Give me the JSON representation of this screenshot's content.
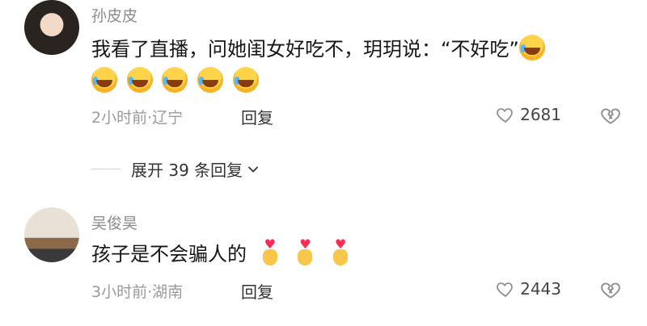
{
  "comments": [
    {
      "username": "孙皮皮",
      "text": "我看了直播，问她闺女好吃不，玥玥说：“不好吃”",
      "emoji_after_text": "laughing-emoji",
      "emoji_line": [
        "laughing-emoji",
        "laughing-emoji",
        "laughing-emoji",
        "laughing-emoji",
        "laughing-emoji"
      ],
      "time_location": "2小时前·辽宁",
      "reply_label": "回复",
      "likes": "2681"
    },
    {
      "username": "吴俊昊",
      "text": "孩子是不会骗人的",
      "emoji_line": [
        "heart-fingers-emoji",
        "heart-fingers-emoji",
        "heart-fingers-emoji"
      ],
      "time_location": "3小时前·湖南",
      "reply_label": "回复",
      "likes": "2443"
    }
  ],
  "expand_replies": {
    "label": "展开 39 条回复"
  }
}
